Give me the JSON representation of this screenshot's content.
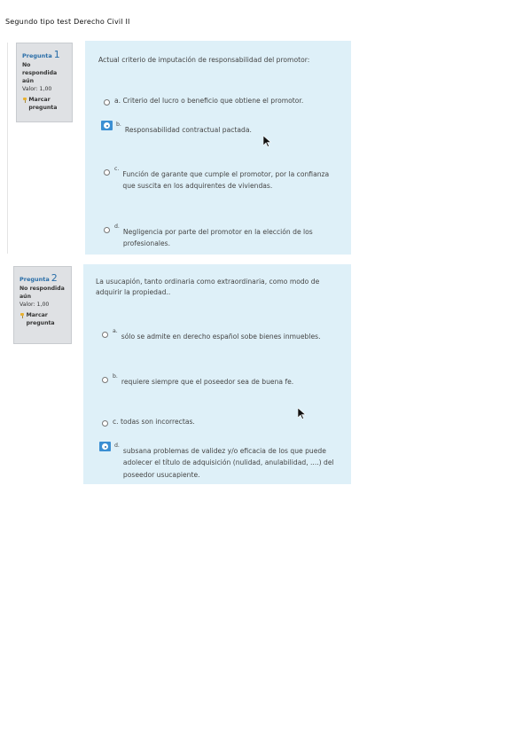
{
  "document": {
    "title": "Segundo tipo test Derecho Civil II"
  },
  "questions": [
    {
      "info": {
        "label": "Pregunta",
        "number": "1",
        "state": "No respondida aún",
        "value": "Valor: 1,00",
        "flag": "Marcar pregunta"
      },
      "text": "Actual criterio de imputación de responsabilidad del promotor:",
      "options": [
        {
          "letter": "a.",
          "text": "Criterio del lucro o beneficio que obtiene el promotor.",
          "selected": false
        },
        {
          "letter": "b.",
          "text": "Responsabilidad contractual pactada.",
          "selected": true
        },
        {
          "letter": "c.",
          "text": "Función de garante que cumple el promotor, por la confianza que suscita en los adquirentes de viviendas.",
          "selected": false
        },
        {
          "letter": "d.",
          "text": "Negligencia por parte del promotor en la elección de los profesionales.",
          "selected": false
        }
      ]
    },
    {
      "info": {
        "label": "Pregunta",
        "number": "2",
        "state": "No respondida aún",
        "value": "Valor: 1,00",
        "flag": "Marcar pregunta"
      },
      "text": "La usucapión, tanto ordinaria como extraordinaria, como modo de adquirir la propiedad..",
      "options": [
        {
          "letter": "a.",
          "text": "sólo se admite en derecho español sobe bienes inmuebles.",
          "selected": false
        },
        {
          "letter": "b.",
          "text": "requiere siempre que el poseedor sea de buena fe.",
          "selected": false
        },
        {
          "letter": "c.",
          "text": "todas son incorrectas.",
          "selected": false
        },
        {
          "letter": "d.",
          "text": "subsana problemas de validez y/o eficacia de los que puede adolecer el título de adquisición (nulidad, anulabilidad, ....) del poseedor usucapiente.",
          "selected": true
        }
      ]
    }
  ],
  "colors": {
    "panel_bg": "#def0f8",
    "info_bg": "#dfe1e4",
    "accent": "#2a6ea8",
    "selected_radio_bg": "#3b8fd3"
  }
}
